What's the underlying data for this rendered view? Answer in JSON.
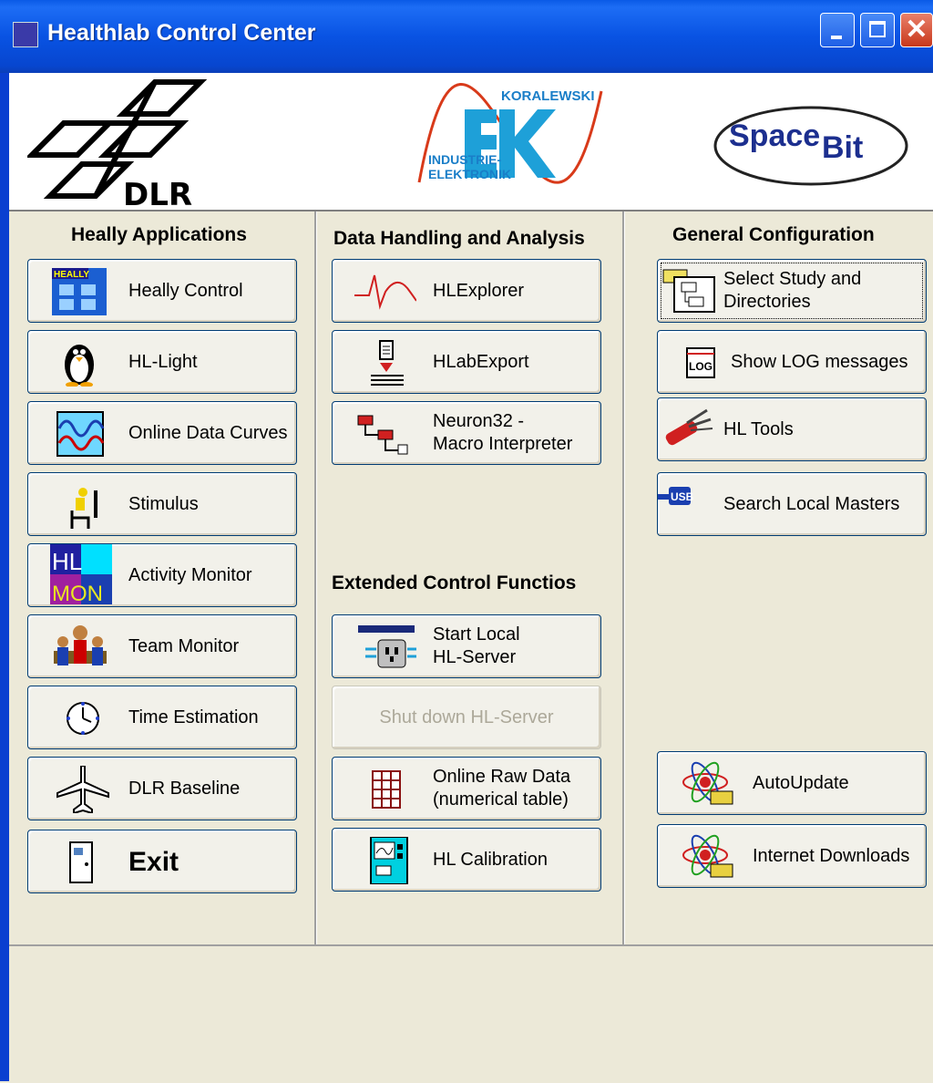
{
  "window": {
    "title": "Healthlab Control Center"
  },
  "logos": {
    "dlr": "DLR",
    "koralewski_top": "KORALEWSKI",
    "koralewski_bottom": "INDUSTRIE-\nELEKTRONIK",
    "spacebit_a": "Space",
    "spacebit_b": "Bit"
  },
  "left": {
    "title": "Heally Applications",
    "buttons": [
      "Heally Control",
      "HL-Light",
      "Online Data Curves",
      "Stimulus",
      "Activity Monitor",
      "Team Monitor",
      "Time Estimation",
      "DLR Baseline",
      "Exit"
    ]
  },
  "middle": {
    "title": "Data Handling and Analysis",
    "buttons": [
      "HLExplorer",
      "HLabExport",
      "Neuron32 -\nMacro Interpreter"
    ],
    "title2": "Extended Control Functios",
    "buttons2": [
      "Start Local\nHL-Server",
      "Shut down HL-Server",
      "Online Raw Data\n(numerical table)",
      "HL Calibration"
    ]
  },
  "right": {
    "title": "General Configuration",
    "buttons": [
      "Select Study and\nDirectories",
      "Show LOG messages",
      "HL Tools",
      "Search Local Masters",
      "AutoUpdate",
      "Internet Downloads"
    ]
  },
  "icon_text": {
    "heally": "HEALLY",
    "hl": "HL",
    "mon": "MON",
    "log": "LOG",
    "usb": "USB"
  }
}
